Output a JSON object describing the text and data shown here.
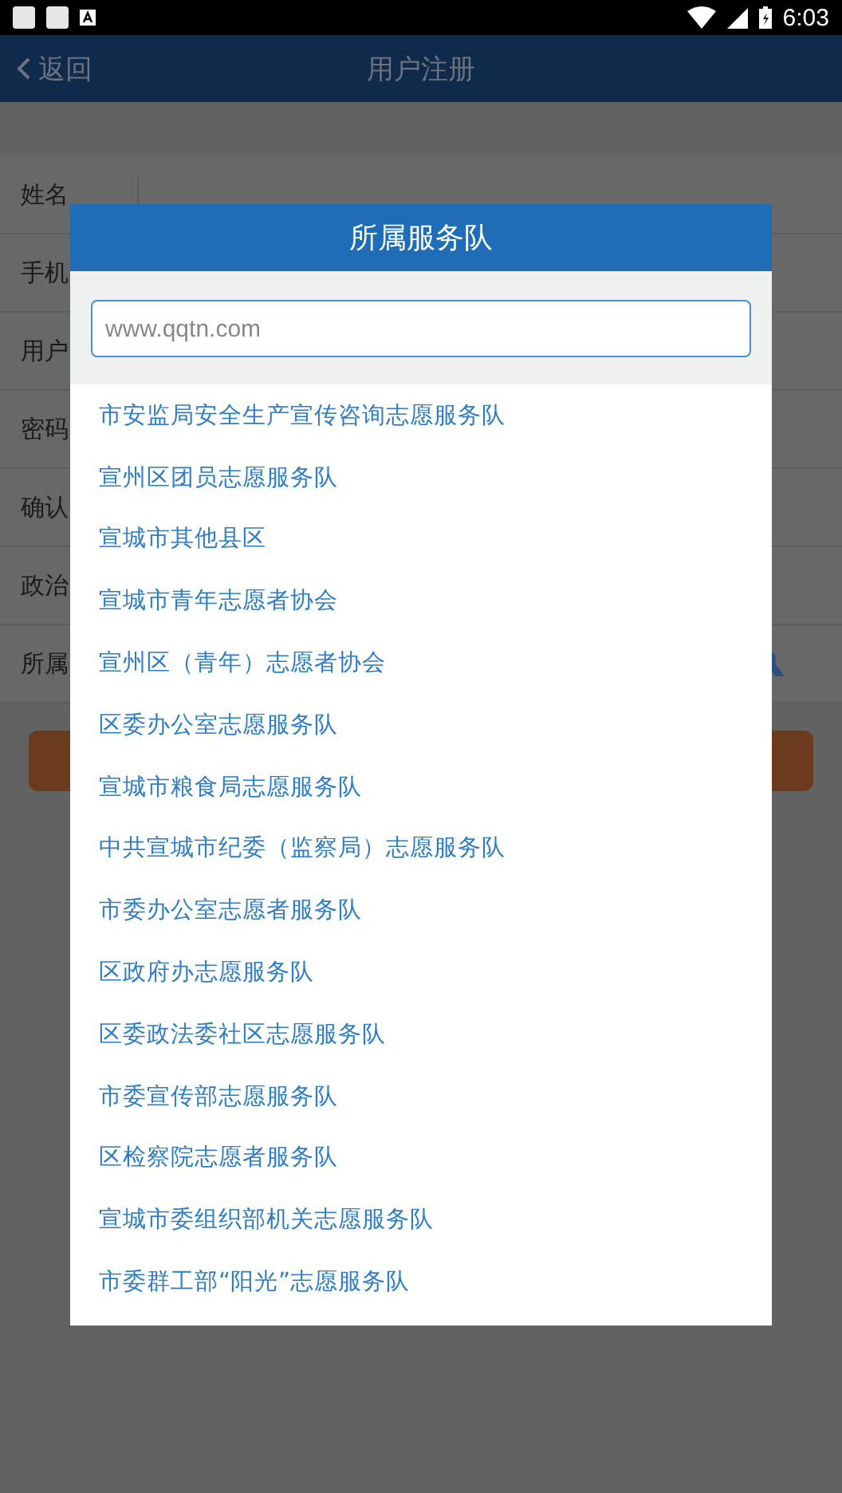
{
  "status_bar": {
    "time": "6:03"
  },
  "header": {
    "back": "返回",
    "title": "用户注册"
  },
  "form": {
    "labels": [
      "姓名",
      "手机",
      "用户",
      "密码",
      "确认",
      "政治",
      "所属"
    ]
  },
  "dialog": {
    "title": "所属服务队",
    "search": {
      "placeholder": "www.qqtn.com"
    },
    "items": [
      "市安监局安全生产宣传咨询志愿服务队",
      "宣州区团员志愿服务队",
      "宣城市其他县区",
      "宣城市青年志愿者协会",
      "宣州区（青年）志愿者协会",
      "区委办公室志愿服务队",
      "宣城市粮食局志愿服务队",
      "中共宣城市纪委（监察局）志愿服务队",
      "市委办公室志愿者服务队",
      "区政府办志愿服务队",
      "区委政法委社区志愿服务队",
      "市委宣传部志愿服务队",
      "区检察院志愿者服务队",
      "宣城市委组织部机关志愿服务队",
      "市委群工部“阳光”志愿服务队"
    ]
  }
}
